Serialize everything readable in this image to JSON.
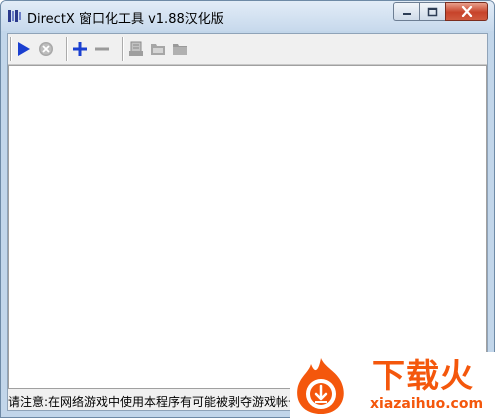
{
  "window": {
    "title": "DirectX 窗口化工具 v1.88汉化版"
  },
  "toolbar": {
    "buttons": [
      {
        "name": "play-icon"
      },
      {
        "name": "stop-icon"
      },
      {
        "name": "add-icon"
      },
      {
        "name": "remove-icon"
      },
      {
        "name": "edit-icon"
      },
      {
        "name": "open-folder-icon"
      },
      {
        "name": "folder-icon"
      }
    ]
  },
  "statusbar": {
    "text": "请注意:在网络游戏中使用本程序有可能被剥夺游戏帐号"
  },
  "watermark": {
    "title": "下载火",
    "domain": "xiazaihuo.com"
  },
  "colors": {
    "accent": "#1a3fd0",
    "watermark": "#f4570c",
    "close_button": "#c7432a"
  }
}
